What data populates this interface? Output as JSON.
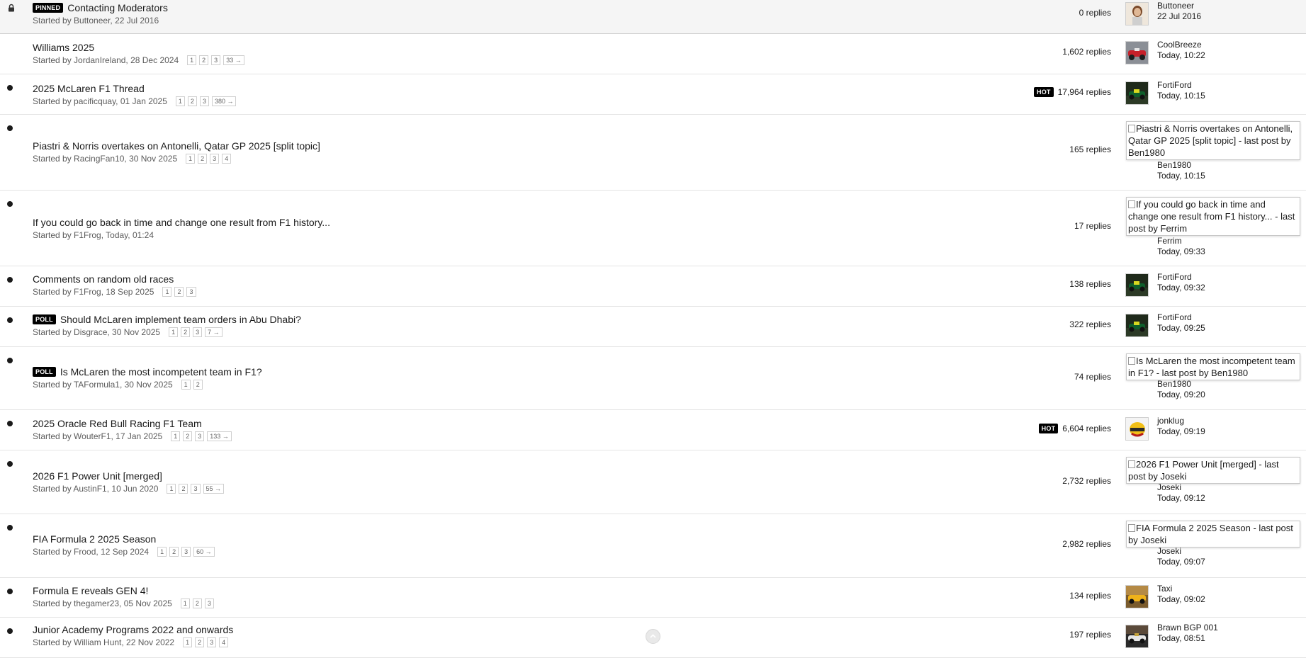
{
  "topics": [
    {
      "title": "Contacting Moderators",
      "badge": "PINNED",
      "started_by": "Started by Buttoneer, 22 Jul 2016",
      "pages": [],
      "hot": "",
      "replies": "0 replies",
      "last_poster": "Buttoneer",
      "last_time": "22 Jul 2016",
      "avatar_alt": "",
      "state": "locked"
    },
    {
      "title": "Williams 2025",
      "badge": "",
      "started_by": "Started by JordanIreland, 28 Dec 2024",
      "pages": [
        "1",
        "2",
        "3",
        "33 →"
      ],
      "hot": "",
      "replies": "1,602 replies",
      "last_poster": "CoolBreeze",
      "last_time": "Today, 10:22",
      "avatar_alt": "",
      "state": "read"
    },
    {
      "title": "2025 McLaren F1 Thread",
      "badge": "",
      "started_by": "Started by pacificquay, 01 Jan 2025",
      "pages": [
        "1",
        "2",
        "3",
        "380 →"
      ],
      "hot": "HOT",
      "replies": "17,964 replies",
      "last_poster": "FortiFord",
      "last_time": "Today, 10:15",
      "avatar_alt": "",
      "state": "unread"
    },
    {
      "title": "Piastri & Norris overtakes on Antonelli, Qatar GP 2025 [split topic]",
      "badge": "",
      "started_by": "Started by RacingFan10, 30 Nov 2025",
      "pages": [
        "1",
        "2",
        "3",
        "4"
      ],
      "hot": "",
      "replies": "165 replies",
      "last_poster": "Ben1980",
      "last_time": "Today, 10:15",
      "avatar_alt": "Piastri & Norris overtakes on Antonelli, Qatar GP 2025 [split topic] - last post by Ben1980",
      "state": "unread"
    },
    {
      "title": "If you could go back in time and change one result from F1 history...",
      "badge": "",
      "started_by": "Started by F1Frog, Today, 01:24",
      "pages": [],
      "hot": "",
      "replies": "17 replies",
      "last_poster": "Ferrim",
      "last_time": "Today, 09:33",
      "avatar_alt": "If you could go back in time and change one result from F1 history... - last post by Ferrim",
      "state": "unread"
    },
    {
      "title": "Comments on random old races",
      "badge": "",
      "started_by": "Started by F1Frog, 18 Sep 2025",
      "pages": [
        "1",
        "2",
        "3"
      ],
      "hot": "",
      "replies": "138 replies",
      "last_poster": "FortiFord",
      "last_time": "Today, 09:32",
      "avatar_alt": "",
      "state": "unread"
    },
    {
      "title": "Should McLaren implement team orders in Abu Dhabi?",
      "badge": "POLL",
      "started_by": "Started by Disgrace, 30 Nov 2025",
      "pages": [
        "1",
        "2",
        "3",
        "7 →"
      ],
      "hot": "",
      "replies": "322 replies",
      "last_poster": "FortiFord",
      "last_time": "Today, 09:25",
      "avatar_alt": "",
      "state": "unread"
    },
    {
      "title": "Is McLaren the most incompetent team in F1?",
      "badge": "POLL",
      "started_by": "Started by TAFormula1, 30 Nov 2025",
      "pages": [
        "1",
        "2"
      ],
      "hot": "",
      "replies": "74 replies",
      "last_poster": "Ben1980",
      "last_time": "Today, 09:20",
      "avatar_alt": "Is McLaren the most incompetent team in F1? - last post by Ben1980",
      "state": "unread"
    },
    {
      "title": "2025 Oracle Red Bull Racing F1 Team",
      "badge": "",
      "started_by": "Started by WouterF1, 17 Jan 2025",
      "pages": [
        "1",
        "2",
        "3",
        "133 →"
      ],
      "hot": "HOT",
      "replies": "6,604 replies",
      "last_poster": "jonklug",
      "last_time": "Today, 09:19",
      "avatar_alt": "",
      "state": "unread"
    },
    {
      "title": "2026 F1 Power Unit [merged]",
      "badge": "",
      "started_by": "Started by AustinF1, 10 Jun 2020",
      "pages": [
        "1",
        "2",
        "3",
        "55 →"
      ],
      "hot": "",
      "replies": "2,732 replies",
      "last_poster": "Joseki",
      "last_time": "Today, 09:12",
      "avatar_alt": "2026 F1 Power Unit [merged] - last post by Joseki",
      "state": "unread"
    },
    {
      "title": "FIA Formula 2 2025 Season",
      "badge": "",
      "started_by": "Started by Frood, 12 Sep 2024",
      "pages": [
        "1",
        "2",
        "3",
        "60 →"
      ],
      "hot": "",
      "replies": "2,982 replies",
      "last_poster": "Joseki",
      "last_time": "Today, 09:07",
      "avatar_alt": "FIA Formula 2 2025 Season - last post by Joseki",
      "state": "unread"
    },
    {
      "title": "Formula E reveals GEN 4!",
      "badge": "",
      "started_by": "Started by thegamer23, 05 Nov 2025",
      "pages": [
        "1",
        "2",
        "3"
      ],
      "hot": "",
      "replies": "134 replies",
      "last_poster": "Taxi",
      "last_time": "Today, 09:02",
      "avatar_alt": "",
      "state": "unread"
    },
    {
      "title": "Junior Academy Programs 2022 and onwards",
      "badge": "",
      "started_by": "Started by William Hunt, 22 Nov 2022",
      "pages": [
        "1",
        "2",
        "3",
        "4"
      ],
      "hot": "",
      "replies": "197 replies",
      "last_poster": "Brawn BGP 001",
      "last_time": "Today, 08:51",
      "avatar_alt": "",
      "state": "unread"
    }
  ],
  "avatars": [
    "person-photo",
    "racing-car",
    "green-car",
    "",
    "",
    "green-car",
    "green-car",
    "",
    "helmet",
    "",
    "",
    "yellow-car",
    "dark-car"
  ],
  "scroll_button": "scroll-to-top-icon"
}
